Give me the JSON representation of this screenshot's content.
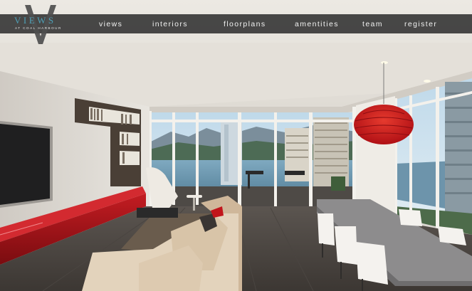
{
  "brand": {
    "logo_letter": "V",
    "logo_word": "VIEWS",
    "logo_tagline": "AT COAL HARBOUR"
  },
  "nav": {
    "views": "views",
    "interiors": "interiors",
    "floorplans": "floorplans",
    "amenities": "amentities",
    "team": "team",
    "register": "register"
  },
  "colors": {
    "nav_bar": "#3a3a3a",
    "logo_accent": "#4e9fb6",
    "cabinet_red": "#a8141b",
    "pendant_red": "#c8181c"
  },
  "hero": {
    "description_icons": [
      "tv-icon",
      "bookshelf-icon",
      "sofa-icon",
      "pendant-lamp-icon",
      "dining-table-icon",
      "window-icon"
    ]
  }
}
